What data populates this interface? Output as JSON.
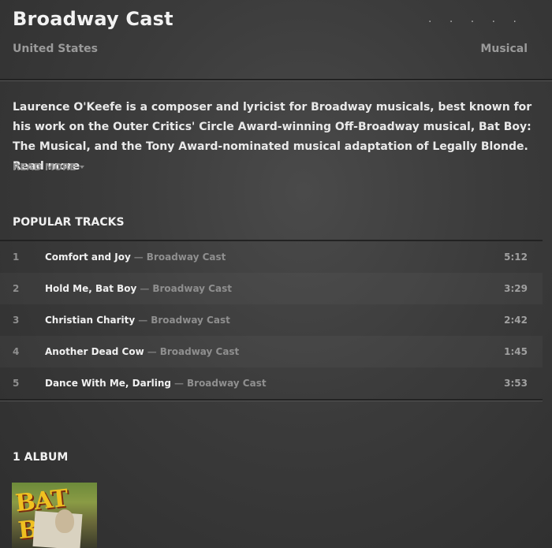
{
  "artist": {
    "name": "Broadway Cast",
    "country": "United States",
    "genre": "Musical",
    "more_menu": "· · · · ·"
  },
  "bio": {
    "text": "Laurence O'Keefe is a composer and lyricist for Broadway musicals, best known for his work on the Outer Critics' Circle Award-winning Off-Broadway musical, Bat Boy: The Musical, and the Tony Award-nominated musical adaptation of Legally Blonde.",
    "inline_link": "Read more",
    "read_more_label": "READ MORE"
  },
  "popular_tracks": {
    "title": "POPULAR TRACKS",
    "separator": "—",
    "items": [
      {
        "num": "1",
        "title": "Comfort and Joy",
        "artist": "Broadway Cast",
        "duration": "5:12"
      },
      {
        "num": "2",
        "title": "Hold Me, Bat Boy",
        "artist": "Broadway Cast",
        "duration": "3:29"
      },
      {
        "num": "3",
        "title": "Christian Charity",
        "artist": "Broadway Cast",
        "duration": "2:42"
      },
      {
        "num": "4",
        "title": "Another Dead Cow",
        "artist": "Broadway Cast",
        "duration": "1:45"
      },
      {
        "num": "5",
        "title": "Dance With Me, Darling",
        "artist": "Broadway Cast",
        "duration": "3:53"
      }
    ]
  },
  "albums": {
    "title": "1 ALBUM",
    "items": [
      {
        "cover_text": "BAT BOY"
      }
    ]
  }
}
